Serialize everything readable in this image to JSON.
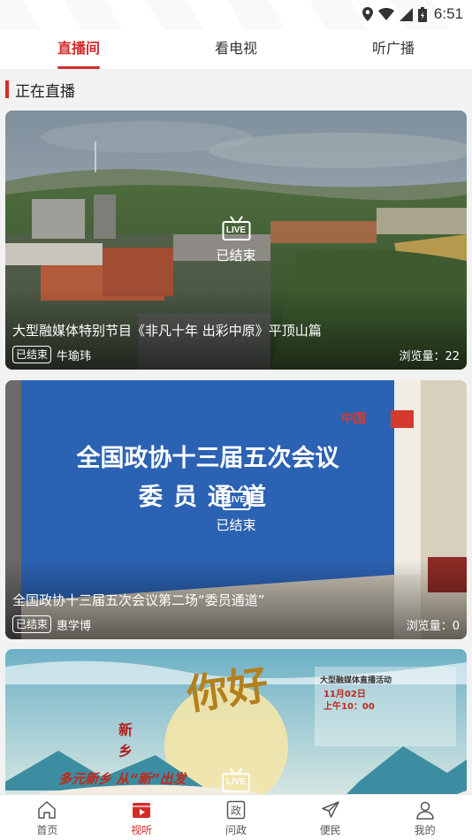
{
  "status_bar": {
    "time": "6:51"
  },
  "top_tabs": [
    {
      "label": "直播间",
      "active": true
    },
    {
      "label": "看电视",
      "active": false
    },
    {
      "label": "听广播",
      "active": false
    }
  ],
  "section": {
    "title": "正在直播"
  },
  "cards": [
    {
      "live_badge": "LIVE",
      "status": "已结束",
      "title": "大型融媒体特别节目《非凡十年 出彩中原》平顶山篇",
      "ended_badge": "已结束",
      "host": "牛瑜玮",
      "views": "浏览量：22"
    },
    {
      "live_badge": "LIVE",
      "status": "已结束",
      "title": "全国政协十三届五次会议第二场“委员通道”",
      "ended_badge": "已结束",
      "host": "惠学博",
      "views": "浏览量：0",
      "poster_text": [
        "全国政协十三届五次会议",
        "委员通道"
      ]
    },
    {
      "live_badge": "LIVE",
      "poster_text": [
        "你好",
        "新乡",
        "多元新乡 从“新”出发",
        "大型融媒体直播活动",
        "11月02日",
        "上午10：00"
      ]
    }
  ],
  "bottom_nav": [
    {
      "label": "首页",
      "icon": "home-icon",
      "active": false
    },
    {
      "label": "视听",
      "icon": "video-play-icon",
      "active": true
    },
    {
      "label": "问政",
      "icon": "politics-icon",
      "active": false
    },
    {
      "label": "便民",
      "icon": "send-arrow-icon",
      "active": false
    },
    {
      "label": "我的",
      "icon": "user-icon",
      "active": false
    }
  ],
  "colors": {
    "accent": "#d42a2a",
    "background": "#f2f2f2"
  }
}
